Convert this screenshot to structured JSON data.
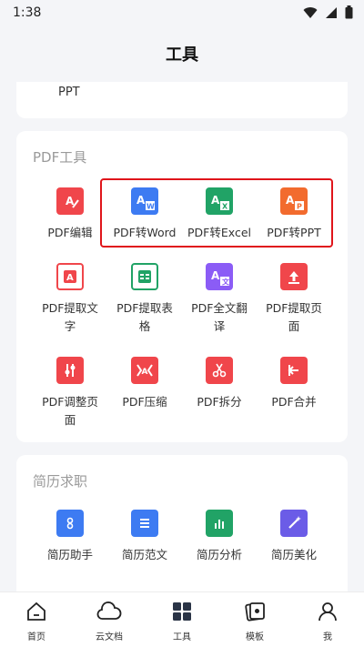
{
  "status_bar": {
    "time": "1:38"
  },
  "header": {
    "title": "工具"
  },
  "top_card": {
    "peek_label": "PPT"
  },
  "pdf_section": {
    "title": "PDF工具",
    "tools": [
      {
        "label": "PDF编辑",
        "icon": "pdf-edit-icon",
        "color": "#f0464b"
      },
      {
        "label": "PDF转Word",
        "icon": "word-icon",
        "color": "#3d7bf2"
      },
      {
        "label": "PDF转Excel",
        "icon": "excel-icon",
        "color": "#21a366"
      },
      {
        "label": "PDF转PPT",
        "icon": "ppt-icon",
        "color": "#f26b2e"
      },
      {
        "label": "PDF提取文字",
        "icon": "text-extract-icon",
        "color": "#f0464b"
      },
      {
        "label": "PDF提取表格",
        "icon": "table-extract-icon",
        "color": "#21a366"
      },
      {
        "label": "PDF全文翻译",
        "icon": "translate-icon",
        "color": "#8b5cf6"
      },
      {
        "label": "PDF提取页面",
        "icon": "page-extract-icon",
        "color": "#f0464b"
      },
      {
        "label": "PDF调整页面",
        "icon": "adjust-page-icon",
        "color": "#f0464b"
      },
      {
        "label": "PDF压缩",
        "icon": "compress-icon",
        "color": "#f0464b"
      },
      {
        "label": "PDF拆分",
        "icon": "split-icon",
        "color": "#f0464b"
      },
      {
        "label": "PDF合并",
        "icon": "merge-icon",
        "color": "#f0464b"
      }
    ]
  },
  "resume_section": {
    "title": "简历求职",
    "tools": [
      {
        "label": "简历助手",
        "icon": "resume-assistant-icon",
        "color": "#3d7bf2"
      },
      {
        "label": "简历范文",
        "icon": "resume-sample-icon",
        "color": "#3d7bf2"
      },
      {
        "label": "简历分析",
        "icon": "resume-analysis-icon",
        "color": "#21a366"
      },
      {
        "label": "简历美化",
        "icon": "resume-beautify-icon",
        "color": "#6b5ce7"
      }
    ]
  },
  "tabbar": {
    "tabs": [
      {
        "label": "首页",
        "icon": "home-icon"
      },
      {
        "label": "云文档",
        "icon": "cloud-icon"
      },
      {
        "label": "工具",
        "icon": "tools-grid-icon",
        "active": true
      },
      {
        "label": "模板",
        "icon": "template-icon"
      },
      {
        "label": "我",
        "icon": "user-icon"
      }
    ]
  }
}
